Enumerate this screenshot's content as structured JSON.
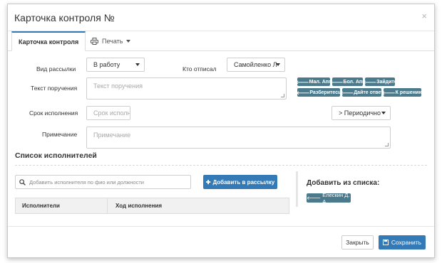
{
  "dialog": {
    "title": "Карточка контроля №",
    "close_glyph": "×"
  },
  "tabs": {
    "card": "Карточка контроля",
    "print": "Печать"
  },
  "form": {
    "mailing_label": "Вид рассылки",
    "mailing_value": "В работу",
    "signed_label": "Кто отписал",
    "signed_value": "Самойленко Л",
    "order_label": "Текст поручения",
    "order_placeholder": "Текст поручения",
    "deadline_label": "Срок исполнения",
    "deadline_placeholder": "Срок исполн",
    "period_value": "> Периодично",
    "note_label": "Примечание",
    "note_placeholder": "Примечание"
  },
  "quick_buttons": [
    "Мал. Апп",
    "Бол. Апп",
    "Зайдите",
    "Разберитесь",
    "Дайте ответ",
    "К решению"
  ],
  "executors": {
    "title": "Список исполнителей",
    "search_placeholder": "Добавить исполнителя по фио или должности",
    "add_button": "Добавить в рассылку",
    "col_executors": "Исполнители",
    "col_progress": "Ход исполнения",
    "add_from_list": "Добавить из списка:",
    "person": "Елескин Д. А."
  },
  "footer": {
    "close": "Закрыть",
    "save": "Сохранить"
  }
}
